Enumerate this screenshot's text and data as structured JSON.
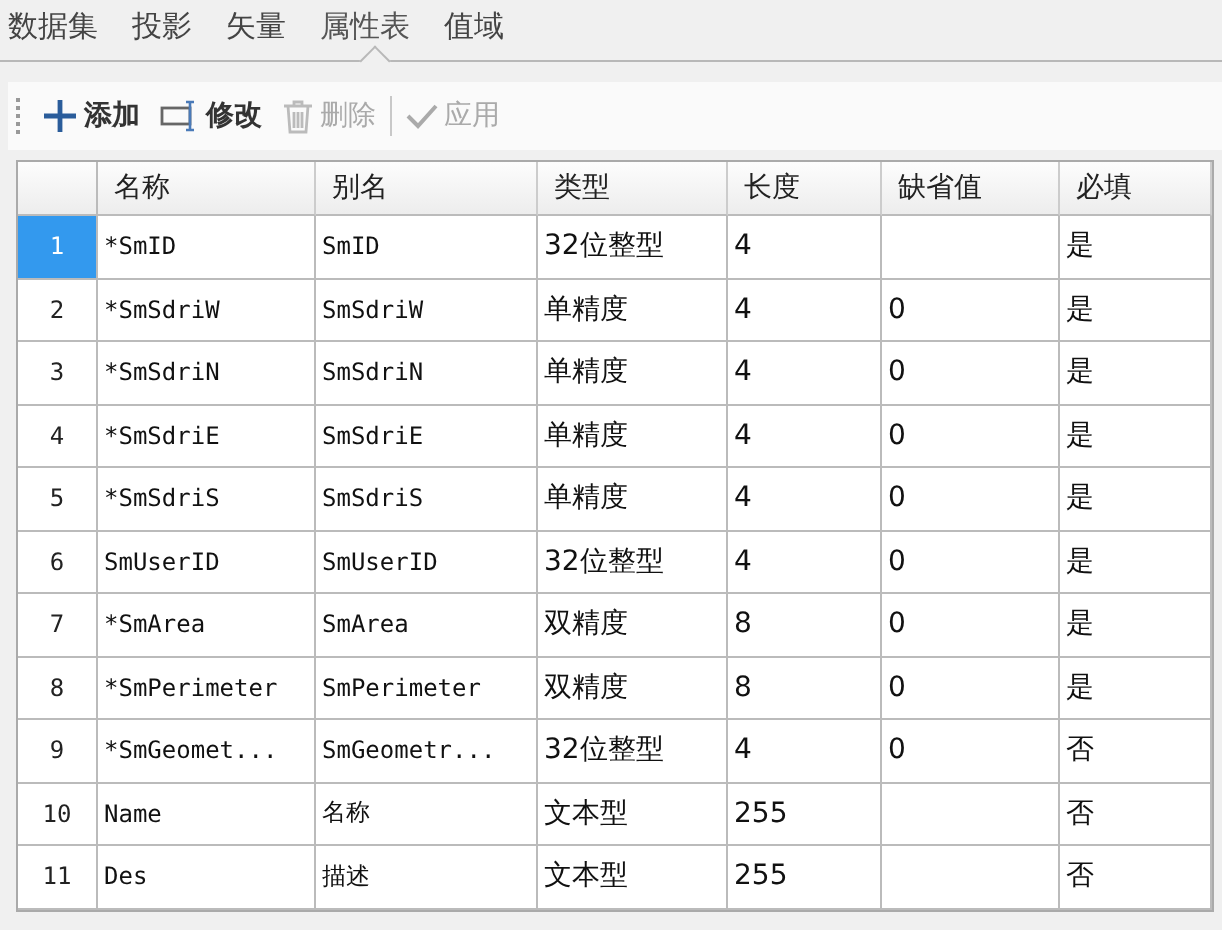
{
  "tabs": [
    {
      "label": "数据集",
      "selected": false
    },
    {
      "label": "投影",
      "selected": false
    },
    {
      "label": "矢量",
      "selected": false
    },
    {
      "label": "属性表",
      "selected": true
    },
    {
      "label": "值域",
      "selected": false
    }
  ],
  "toolbar": [
    {
      "kind": "add",
      "label": "添加",
      "disabled": false
    },
    {
      "kind": "edit",
      "label": "修改",
      "disabled": false
    },
    {
      "kind": "delete",
      "label": "删除",
      "disabled": true
    },
    {
      "kind": "apply",
      "label": "应用",
      "disabled": true
    }
  ],
  "table": {
    "columns": [
      "名称",
      "别名",
      "类型",
      "长度",
      "缺省值",
      "必填"
    ],
    "rows": [
      {
        "index": "1",
        "selected": true,
        "cells": [
          "*SmID",
          "SmID",
          "32位整型",
          "4",
          "",
          "是"
        ]
      },
      {
        "index": "2",
        "selected": false,
        "cells": [
          "*SmSdriW",
          "SmSdriW",
          "单精度",
          "4",
          "0",
          "是"
        ]
      },
      {
        "index": "3",
        "selected": false,
        "cells": [
          "*SmSdriN",
          "SmSdriN",
          "单精度",
          "4",
          "0",
          "是"
        ]
      },
      {
        "index": "4",
        "selected": false,
        "cells": [
          "*SmSdriE",
          "SmSdriE",
          "单精度",
          "4",
          "0",
          "是"
        ]
      },
      {
        "index": "5",
        "selected": false,
        "cells": [
          "*SmSdriS",
          "SmSdriS",
          "单精度",
          "4",
          "0",
          "是"
        ]
      },
      {
        "index": "6",
        "selected": false,
        "cells": [
          "SmUserID",
          "SmUserID",
          "32位整型",
          "4",
          "0",
          "是"
        ]
      },
      {
        "index": "7",
        "selected": false,
        "cells": [
          "*SmArea",
          "SmArea",
          "双精度",
          "8",
          "0",
          "是"
        ]
      },
      {
        "index": "8",
        "selected": false,
        "cells": [
          "*SmPerimeter",
          "SmPerimeter",
          "双精度",
          "8",
          "0",
          "是"
        ]
      },
      {
        "index": "9",
        "selected": false,
        "cells": [
          "*SmGeomet...",
          "SmGeometr...",
          "32位整型",
          "4",
          "0",
          "否"
        ]
      },
      {
        "index": "10",
        "selected": false,
        "cells": [
          "Name",
          "名称",
          "文本型",
          "255",
          "",
          "否"
        ]
      },
      {
        "index": "11",
        "selected": false,
        "cells": [
          "Des",
          "描述",
          "文本型",
          "255",
          "",
          "否"
        ]
      }
    ]
  }
}
